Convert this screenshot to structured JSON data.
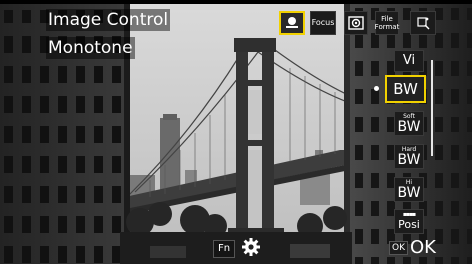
{
  "header": {
    "title": "Image Control",
    "mode": "Monotone"
  },
  "top_icons": [
    {
      "name": "image-control-icon",
      "label": "",
      "selected": true
    },
    {
      "name": "focus-icon",
      "label": "Focus",
      "selected": false
    },
    {
      "name": "metering-icon",
      "label": "",
      "selected": false
    },
    {
      "name": "file-format-icon",
      "label": "File Format",
      "selected": false
    },
    {
      "name": "wireless-icon",
      "label": "",
      "selected": false
    }
  ],
  "options": [
    {
      "name": "option-vivid",
      "top": "",
      "main": "Vi",
      "selected": false
    },
    {
      "name": "option-bw",
      "top": "",
      "main": "BW",
      "selected": true
    },
    {
      "name": "option-soft-bw",
      "top": "Soft",
      "main": "BW",
      "selected": false
    },
    {
      "name": "option-hard-bw",
      "top": "Hard",
      "main": "BW",
      "selected": false
    },
    {
      "name": "option-hi-bw",
      "top": "Hi",
      "main": "BW",
      "selected": false
    },
    {
      "name": "option-posi",
      "top": "",
      "main": "Posi",
      "selected": false
    }
  ],
  "bottom": {
    "fn_label": "Fn",
    "ok_badge": "OK",
    "ok_label": "OK"
  },
  "colors": {
    "accent": "#f1d100",
    "text": "#ffffff"
  }
}
